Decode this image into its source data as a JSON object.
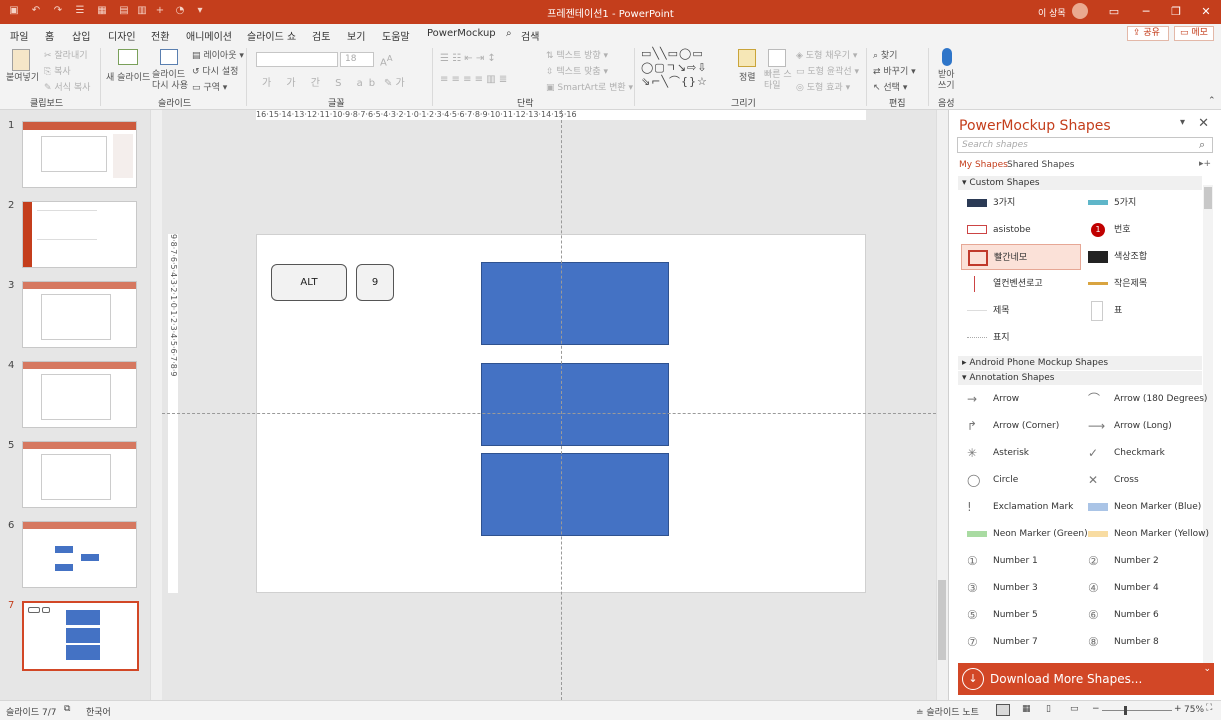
{
  "window": {
    "title": "프레젠테이션1 - PowerPoint",
    "user": "이 상목"
  },
  "tabs": [
    "파일",
    "홈",
    "삽입",
    "디자인",
    "전환",
    "애니메이션",
    "슬라이드 쇼",
    "검토",
    "보기",
    "도움말",
    "PowerMockup",
    "검색"
  ],
  "share_label": "공유",
  "memo_label": "메모",
  "ribbon": {
    "clipboard": {
      "paste": "붙여넣기",
      "cut": "잘라내기",
      "copy": "복사",
      "format_painter": "서식 복사",
      "group": "클립보드"
    },
    "slides": {
      "new_slide": "새 슬라이드",
      "reuse": "슬라이드 다시 사용",
      "layout": "레이아웃",
      "reset": "다시 설정",
      "section": "구역",
      "group": "슬라이드"
    },
    "font": {
      "size": "18",
      "group": "글꼴"
    },
    "paragraph": {
      "text_direction": "텍스트 방향",
      "align_text": "텍스트 맞춤",
      "smartart": "SmartArt로 변환",
      "group": "단락"
    },
    "drawing": {
      "arrange": "정렬",
      "quick_styles": "빠른 스타일",
      "fill": "도형 채우기",
      "outline": "도형 윤곽선",
      "effects": "도형 효과",
      "group": "그리기"
    },
    "editing": {
      "find": "찾기",
      "replace": "바꾸기",
      "select": "선택",
      "group": "편집"
    },
    "voice": {
      "dictate": "받아쓰기",
      "group": "음성"
    }
  },
  "thumbnails": [
    "1",
    "2",
    "3",
    "4",
    "5",
    "6",
    "7"
  ],
  "slide": {
    "keys": [
      "ALT",
      "9"
    ]
  },
  "ruler_h": "16·15·14·13·12·11·10·9·8·7·6·5·4·3·2·1·0·1·2·3·4·5·6·7·8·9·10·11·12·13·14·15·16",
  "ruler_v": "9·8·7·6·5·4·3·2·1·0·1·2·3·4·5·6·7·8·9",
  "pane": {
    "title": "PowerMockup Shapes",
    "search_placeholder": "Search shapes",
    "my_shapes": "My Shapes",
    "shared_shapes": "Shared Shapes",
    "custom_section": "Custom Shapes",
    "custom_items": [
      "3가지",
      "5가지",
      "asistobe",
      "번호",
      "빨간네모",
      "색상조합",
      "열컨벤션로고",
      "작은제목",
      "제목",
      "표",
      "표지"
    ],
    "android_section": "Android Phone Mockup Shapes",
    "annotation_section": "Annotation Shapes",
    "annotation_items": [
      "Arrow",
      "Arrow (180 Degrees)",
      "Arrow (Corner)",
      "Arrow (Long)",
      "Asterisk",
      "Checkmark",
      "Circle",
      "Cross",
      "Exclamation Mark",
      "Neon Marker (Blue)",
      "Neon Marker (Green)",
      "Neon Marker (Yellow)",
      "Number 1",
      "Number 2",
      "Number 3",
      "Number 4",
      "Number 5",
      "Number 6",
      "Number 7",
      "Number 8"
    ],
    "download": "Download More Shapes..."
  },
  "status": {
    "slide_info": "슬라이드 7/7",
    "language": "한국어",
    "notes": "슬라이드 노트",
    "zoom": "75%"
  },
  "colors": {
    "accent": "#c43e1c",
    "shape_blue": "#4472c4"
  }
}
